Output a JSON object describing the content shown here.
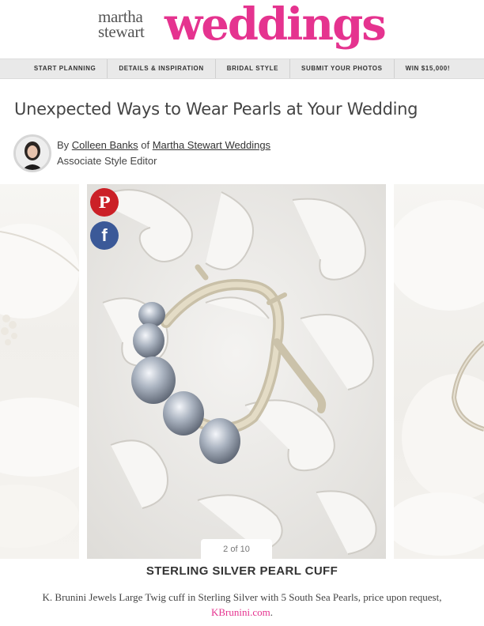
{
  "brand": {
    "line1": "martha",
    "line2": "stewart",
    "wordmark": "weddings",
    "accent_color": "#e5338f"
  },
  "nav": {
    "items": [
      "START PLANNING",
      "DETAILS & INSPIRATION",
      "BRIDAL STYLE",
      "SUBMIT YOUR PHOTOS",
      "WIN $15,000!"
    ]
  },
  "article": {
    "title": "Unexpected Ways to Wear Pearls at Your Wedding",
    "byline_prefix": "By",
    "author": "Colleen Banks",
    "byline_of": "of",
    "publication": "Martha Stewart Weddings",
    "author_role": "Associate Style Editor"
  },
  "share": {
    "pinterest_icon": "pinterest-icon",
    "facebook_icon": "facebook-icon",
    "pinterest_glyph": "P",
    "facebook_glyph": "f"
  },
  "slideshow": {
    "counter": "2 of 10",
    "caption_title": "STERLING SILVER PEARL CUFF",
    "caption_text": "K. Brunini Jewels Large Twig cuff in Sterling Silver with 5 South Sea Pearls, price upon request,",
    "caption_link": "KBrunini.com",
    "caption_end": "."
  }
}
